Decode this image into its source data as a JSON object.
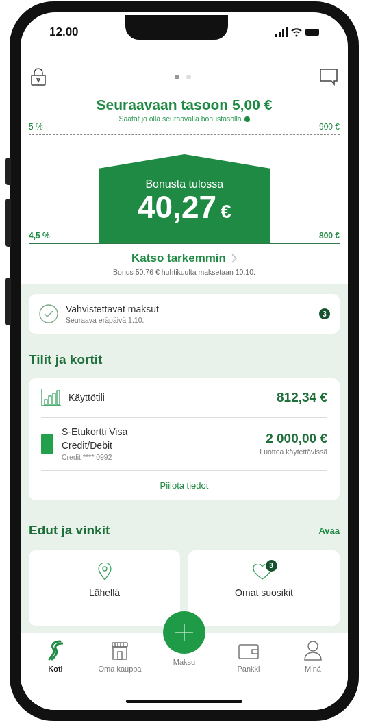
{
  "status_bar": {
    "time": "12.00"
  },
  "header": {
    "pages": [
      {
        "selected": true
      },
      {
        "selected": false
      }
    ]
  },
  "bonus": {
    "next_level_title": "Seuraavaan tasoon 5,00 €",
    "next_level_hint": "Saatat jo olla seuraavalla bonustasolla",
    "next_percent": "5 %",
    "next_amount": "900 €",
    "label": "Bonusta tulossa",
    "amount": "40,27",
    "currency": "€",
    "current_percent": "4,5 %",
    "current_amount": "800 €",
    "details_link": "Katso tarkemmin",
    "note": "Bonus 50,76 € huhtikuulta maksetaan 10.10."
  },
  "pending_payments": {
    "title": "Vahvistettavat maksut",
    "subtitle": "Seuraava eräpäivä 1.10.",
    "count": "3"
  },
  "accounts": {
    "title": "Tilit ja kortit",
    "items": [
      {
        "kind": "account",
        "name": "Käyttötili",
        "amount": "812,34 €"
      },
      {
        "kind": "card",
        "name": "S-Etukortti Visa Credit/Debit",
        "detail": "Credit **** 0992",
        "amount": "2 000,00 €",
        "amount_note": "Luottoa käytettävissä"
      }
    ],
    "toggle": "Piilota tiedot"
  },
  "benefits": {
    "title": "Edut ja vinkit",
    "action": "Avaa",
    "tiles": [
      {
        "kind": "nearby",
        "label": "Lähellä"
      },
      {
        "kind": "favorites",
        "label": "Omat suosikit",
        "badge": "3"
      }
    ]
  },
  "nav": [
    {
      "kind": "home",
      "label": "Koti",
      "selected": true
    },
    {
      "kind": "store",
      "label": "Oma kauppa",
      "selected": false
    },
    {
      "kind": "pay",
      "label": "Maksu",
      "selected": false
    },
    {
      "kind": "bank",
      "label": "Pankki",
      "selected": false
    },
    {
      "kind": "me",
      "label": "Minä",
      "selected": false
    }
  ]
}
